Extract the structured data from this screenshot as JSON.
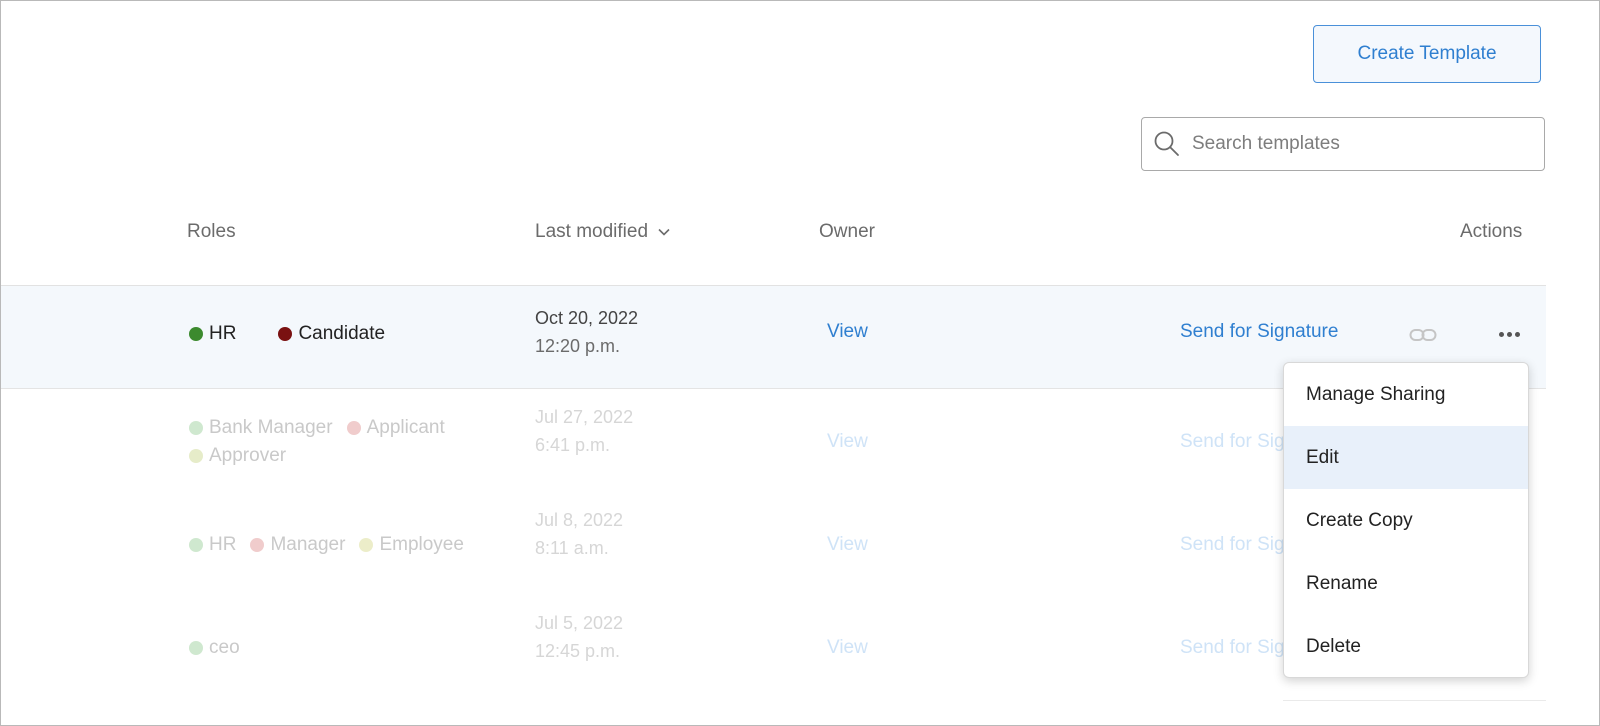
{
  "toolbar": {
    "create_label": "Create Template",
    "search_placeholder": "Search templates",
    "search_icon": "search-icon"
  },
  "columns": {
    "roles": "Roles",
    "last_modified": "Last modified",
    "owner": "Owner",
    "actions": "Actions"
  },
  "rows": [
    {
      "roles": [
        {
          "name": "HR",
          "color": "#3c8a2e"
        },
        {
          "name": "Candidate",
          "color": "#7a1111"
        }
      ],
      "date": "Oct 20, 2022",
      "time": "12:20 p.m.",
      "owner_link": "View",
      "send_label": "Send for Signature"
    },
    {
      "roles": [
        {
          "name": "Bank Manager",
          "color": "#cfe8cf"
        },
        {
          "name": "Applicant",
          "color": "#f0cccc"
        },
        {
          "name": "Approver",
          "color": "#e6ecc9"
        }
      ],
      "date": "Jul 27, 2022",
      "time": "6:41 p.m.",
      "owner_link": "View",
      "send_label": "Send for Sig"
    },
    {
      "roles": [
        {
          "name": "HR",
          "color": "#cfe8cf"
        },
        {
          "name": "Manager",
          "color": "#f0cccc"
        },
        {
          "name": "Employee",
          "color": "#ecedc9"
        }
      ],
      "date": "Jul 8, 2022",
      "time": "8:11 a.m.",
      "owner_link": "View",
      "send_label": "Send for Sig"
    },
    {
      "roles": [
        {
          "name": "ceo",
          "color": "#cfe8cf"
        }
      ],
      "date": "Jul 5, 2022",
      "time": "12:45 p.m.",
      "owner_link": "View",
      "send_label": "Send for Sig"
    }
  ],
  "menu": {
    "items": [
      "Manage Sharing",
      "Edit",
      "Create Copy",
      "Rename",
      "Delete"
    ],
    "active": "Edit"
  },
  "colors": {
    "accent": "#2f7fd0",
    "selected_row_bg": "#f4f8fc",
    "menu_active_bg": "#e8f0fa"
  }
}
